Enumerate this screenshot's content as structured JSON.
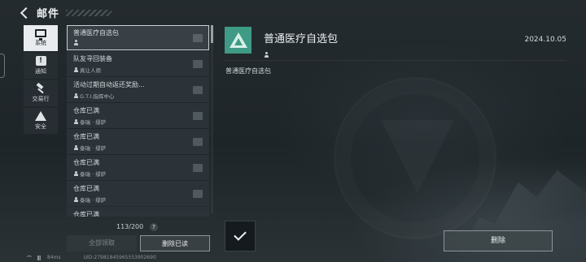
{
  "header": {
    "title": "邮件"
  },
  "categories": [
    {
      "label": "系统",
      "icon": "monitor-icon",
      "active": true
    },
    {
      "label": "通知",
      "icon": "alert-icon",
      "active": false
    },
    {
      "label": "交易行",
      "icon": "hammer-icon",
      "active": false
    },
    {
      "label": "安全",
      "icon": "warning-icon",
      "active": false
    }
  ],
  "mails": [
    {
      "subject": "普通医疗自选包",
      "sender": ""
    },
    {
      "subject": "队友寻回装备",
      "sender": "真让人烦"
    },
    {
      "subject": "活动过期自动返还奖励...",
      "sender": "G.T.I.指挥中心"
    },
    {
      "subject": "仓库已满",
      "sender": "泰瑞 · 缪萨"
    },
    {
      "subject": "仓库已满",
      "sender": "泰瑞 · 缪萨"
    },
    {
      "subject": "仓库已满",
      "sender": "泰瑞 · 缪萨"
    },
    {
      "subject": "仓库已满",
      "sender": "泰瑞 · 缪萨"
    },
    {
      "subject": "仓库已满",
      "sender": ""
    }
  ],
  "list_footer": {
    "count": "113/200",
    "help": "?",
    "claim_all": "全部领取",
    "delete_read": "删除已读"
  },
  "status_bar": {
    "ping": "84ms",
    "uid": "UID:27981845965553902690"
  },
  "detail": {
    "title": "普通医疗自选包",
    "date": "2024.10.05",
    "body": "普通医疗自选包",
    "icon_color": "#3f9a86"
  },
  "actions": {
    "delete": "删除"
  }
}
